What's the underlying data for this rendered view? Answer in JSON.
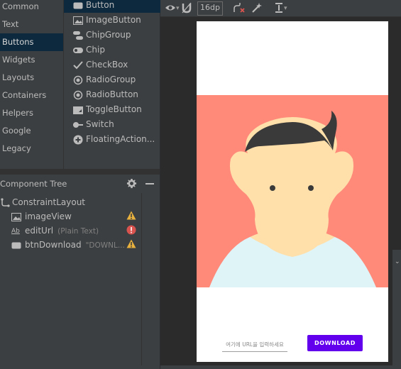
{
  "palette": {
    "categories": [
      "Common",
      "Text",
      "Buttons",
      "Widgets",
      "Layouts",
      "Containers",
      "Helpers",
      "Google",
      "Legacy"
    ],
    "selected_category": "Buttons",
    "items": [
      {
        "label": "Button",
        "icon": "button-icon"
      },
      {
        "label": "ImageButton",
        "icon": "image-button-icon"
      },
      {
        "label": "ChipGroup",
        "icon": "chip-group-icon"
      },
      {
        "label": "Chip",
        "icon": "chip-icon"
      },
      {
        "label": "CheckBox",
        "icon": "checkmark-icon"
      },
      {
        "label": "RadioGroup",
        "icon": "radio-group-icon"
      },
      {
        "label": "RadioButton",
        "icon": "radio-button-icon"
      },
      {
        "label": "ToggleButton",
        "icon": "toggle-button-icon"
      },
      {
        "label": "Switch",
        "icon": "switch-icon"
      },
      {
        "label": "FloatingAction...",
        "icon": "plus-circle-icon"
      }
    ]
  },
  "component_tree": {
    "title": "Component Tree",
    "root": "ConstraintLayout",
    "children": [
      {
        "name": "imageView",
        "detail": "",
        "status": "warning"
      },
      {
        "name": "editUrl",
        "detail": "(Plain Text)",
        "status": "error"
      },
      {
        "name": "btnDownload",
        "detail": "\"DOWNL...",
        "status": "warning"
      }
    ]
  },
  "toolbar": {
    "margin_value": "16dp"
  },
  "preview": {
    "url_hint": "여기에 URL을 입력하세요",
    "download_label": "DOWNLOAD"
  },
  "colors": {
    "hero_background": "#ff8a7a",
    "button_accent": "#6200ee",
    "warning": "#e8b03d",
    "error": "#d9534f"
  }
}
